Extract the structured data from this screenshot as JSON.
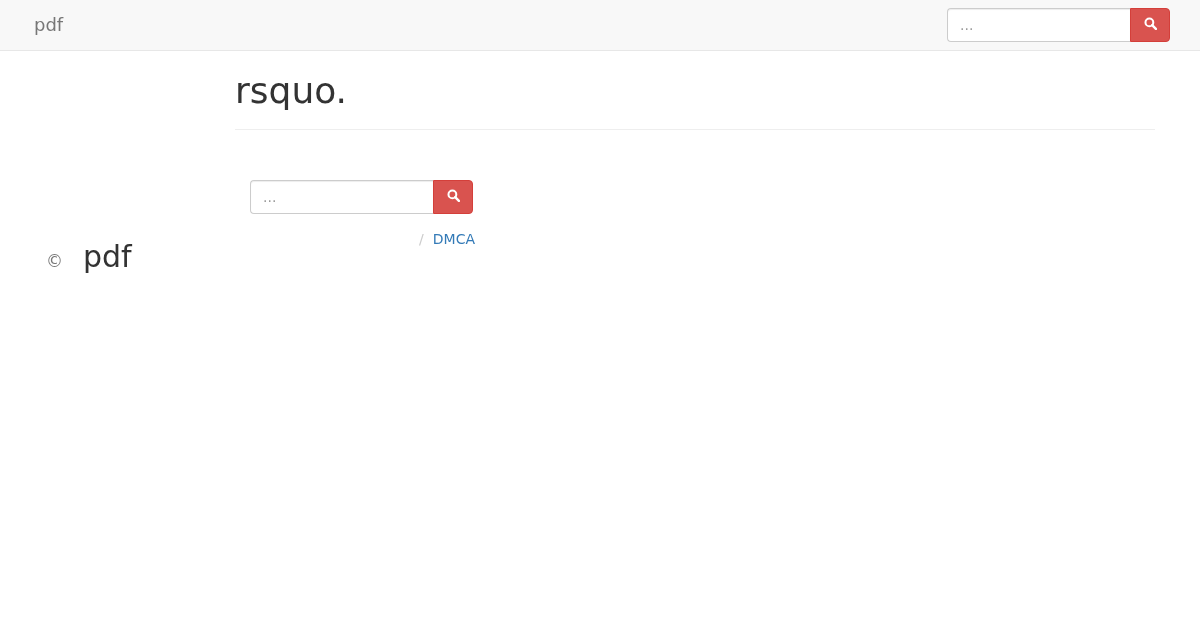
{
  "navbar": {
    "brand": "pdf",
    "search": {
      "placeholder": "..."
    }
  },
  "page_header": {
    "title": "rsquo."
  },
  "search": {
    "placeholder": "..."
  },
  "breadcrumb": [
    {
      "separator": "/",
      "label": "DMCA"
    }
  ],
  "copyright": {
    "symbol": "©",
    "name": "pdf"
  }
}
